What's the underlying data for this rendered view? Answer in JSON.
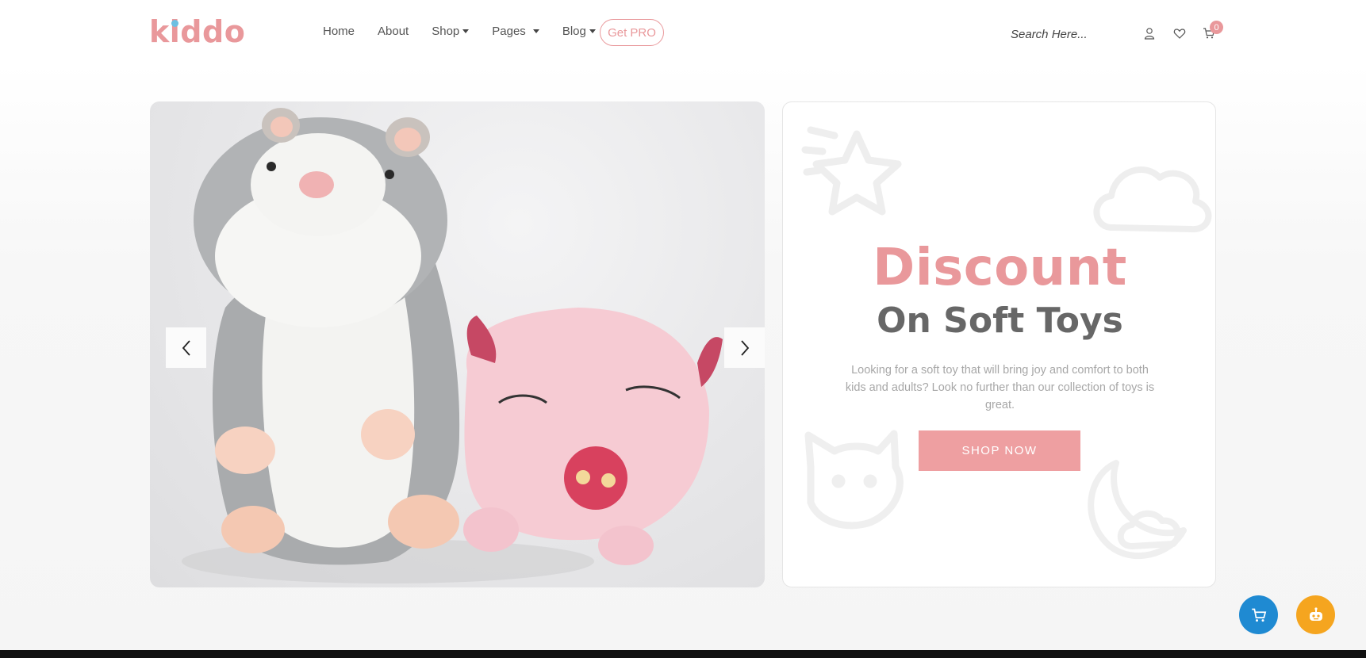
{
  "header": {
    "logo": "kiddo",
    "nav": [
      {
        "label": "Home",
        "dropdown": false
      },
      {
        "label": "About",
        "dropdown": false
      },
      {
        "label": "Shop",
        "dropdown": true
      },
      {
        "label": "Pages",
        "dropdown": true
      },
      {
        "label": "Blog",
        "dropdown": true
      }
    ],
    "get_pro": "Get PRO",
    "search_placeholder": "Search Here...",
    "cart_count": "0"
  },
  "hero": {
    "image_alt": "Plush hamster and pink pig soft toys",
    "prev_icon": "chevron-left-icon",
    "next_icon": "chevron-right-icon"
  },
  "promo": {
    "title": "Discount",
    "subtitle": "On Soft Toys",
    "description": "Looking for a soft toy that will bring joy and comfort to both kids and adults? Look no further than our collection of toys is great.",
    "button": "SHOP NOW"
  },
  "colors": {
    "accent": "#e9989b",
    "logo_dot": "#6ec0e2",
    "fab_cart": "#1f8ad2",
    "fab_bot": "#f5a51f"
  }
}
